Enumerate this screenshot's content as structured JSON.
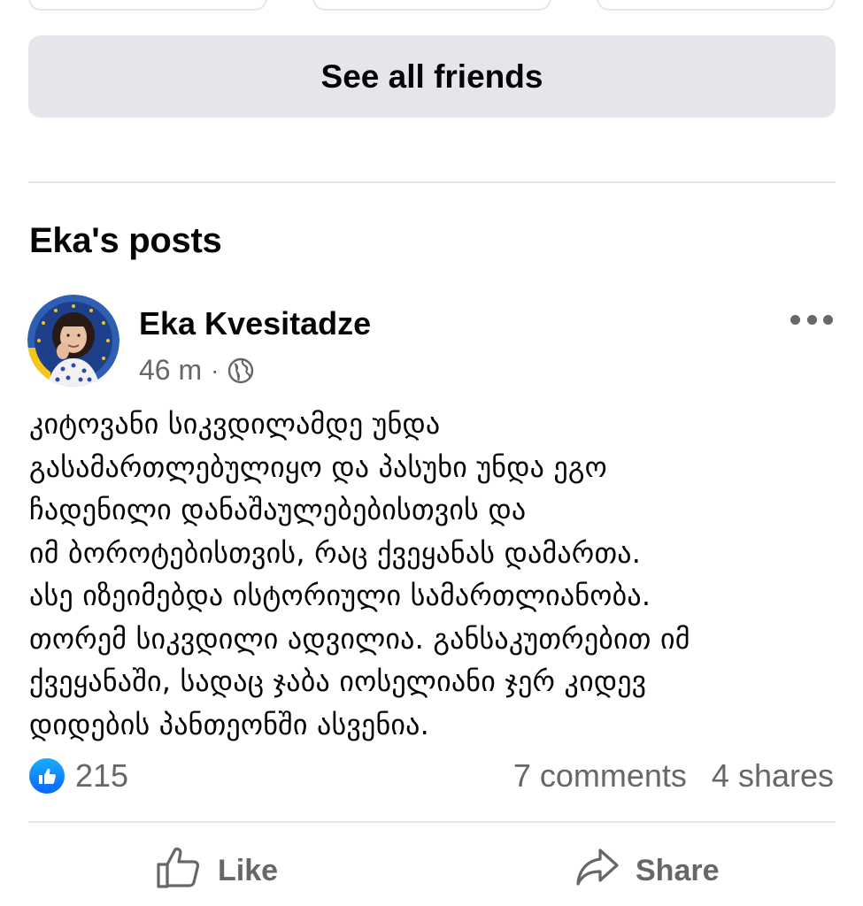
{
  "friends": {
    "see_all_label": "See all friends"
  },
  "posts_section": {
    "title": "Eka's posts"
  },
  "post": {
    "author": "Eka Kvesitadze",
    "time": "46 m",
    "separator": "·",
    "privacy_icon": "globe-icon",
    "more_icon": "more-dots-icon",
    "text_lines": [
      "კიტოვანი სიკვდილამდე უნდა",
      "გასამართლებულიყო და პასუხი უნდა ეგო",
      "ჩადენილი დანაშაულებებისთვის და",
      "იმ ბოროტებისთვის, რაც ქვეყანას დამართა.",
      "ასე იზეიმებდა ისტორიული სამართლიანობა.",
      "თორემ სიკვდილი ადვილია. განსაკუთრებით იმ",
      "ქვეყანაში, სადაც ჯაბა იოსელიანი ჯერ კიდევ",
      "დიდების პანთეონში ასვენია."
    ],
    "reactions": {
      "icon": "like-reaction-icon",
      "count": "215"
    },
    "comments": "7 comments",
    "shares": "4 shares"
  },
  "actions": {
    "like_label": "Like",
    "share_label": "Share"
  },
  "colors": {
    "accent_blue": "#0866ff",
    "secondary_text": "#65676b",
    "button_bg": "#e4e6eb",
    "avatar_ring_blue": "#2f5fb3",
    "avatar_ring_yellow": "#f5c518"
  }
}
